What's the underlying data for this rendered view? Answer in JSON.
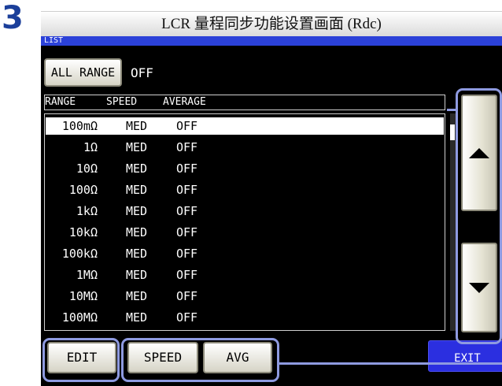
{
  "step": {
    "number": "3"
  },
  "doc_title": "LCR 量程同步功能设置画面 (Rdc)",
  "screen": {
    "title_bar": "LIST",
    "all_range": {
      "button_label": "ALL RANGE",
      "value": "OFF"
    },
    "columns": [
      "RANGE",
      "SPEED",
      "AVERAGE"
    ],
    "rows": [
      {
        "range": "100mΩ",
        "speed": "MED",
        "average": "OFF",
        "selected": true
      },
      {
        "range": "1Ω",
        "speed": "MED",
        "average": "OFF"
      },
      {
        "range": "10Ω",
        "speed": "MED",
        "average": "OFF"
      },
      {
        "range": "100Ω",
        "speed": "MED",
        "average": "OFF"
      },
      {
        "range": "1kΩ",
        "speed": "MED",
        "average": "OFF"
      },
      {
        "range": "10kΩ",
        "speed": "MED",
        "average": "OFF"
      },
      {
        "range": "100kΩ",
        "speed": "MED",
        "average": "OFF"
      },
      {
        "range": "1MΩ",
        "speed": "MED",
        "average": "OFF"
      },
      {
        "range": "10MΩ",
        "speed": "MED",
        "average": "OFF"
      },
      {
        "range": "100MΩ",
        "speed": "MED",
        "average": "OFF"
      }
    ],
    "buttons": {
      "edit": "EDIT",
      "speed": "SPEED",
      "avg": "AVG",
      "exit": "EXIT"
    }
  },
  "colors": {
    "title_bar": "#2b41d8",
    "exit_button": "#2b2fe0",
    "highlight": "#8e9ae0",
    "step_number": "#1b3f9a"
  }
}
